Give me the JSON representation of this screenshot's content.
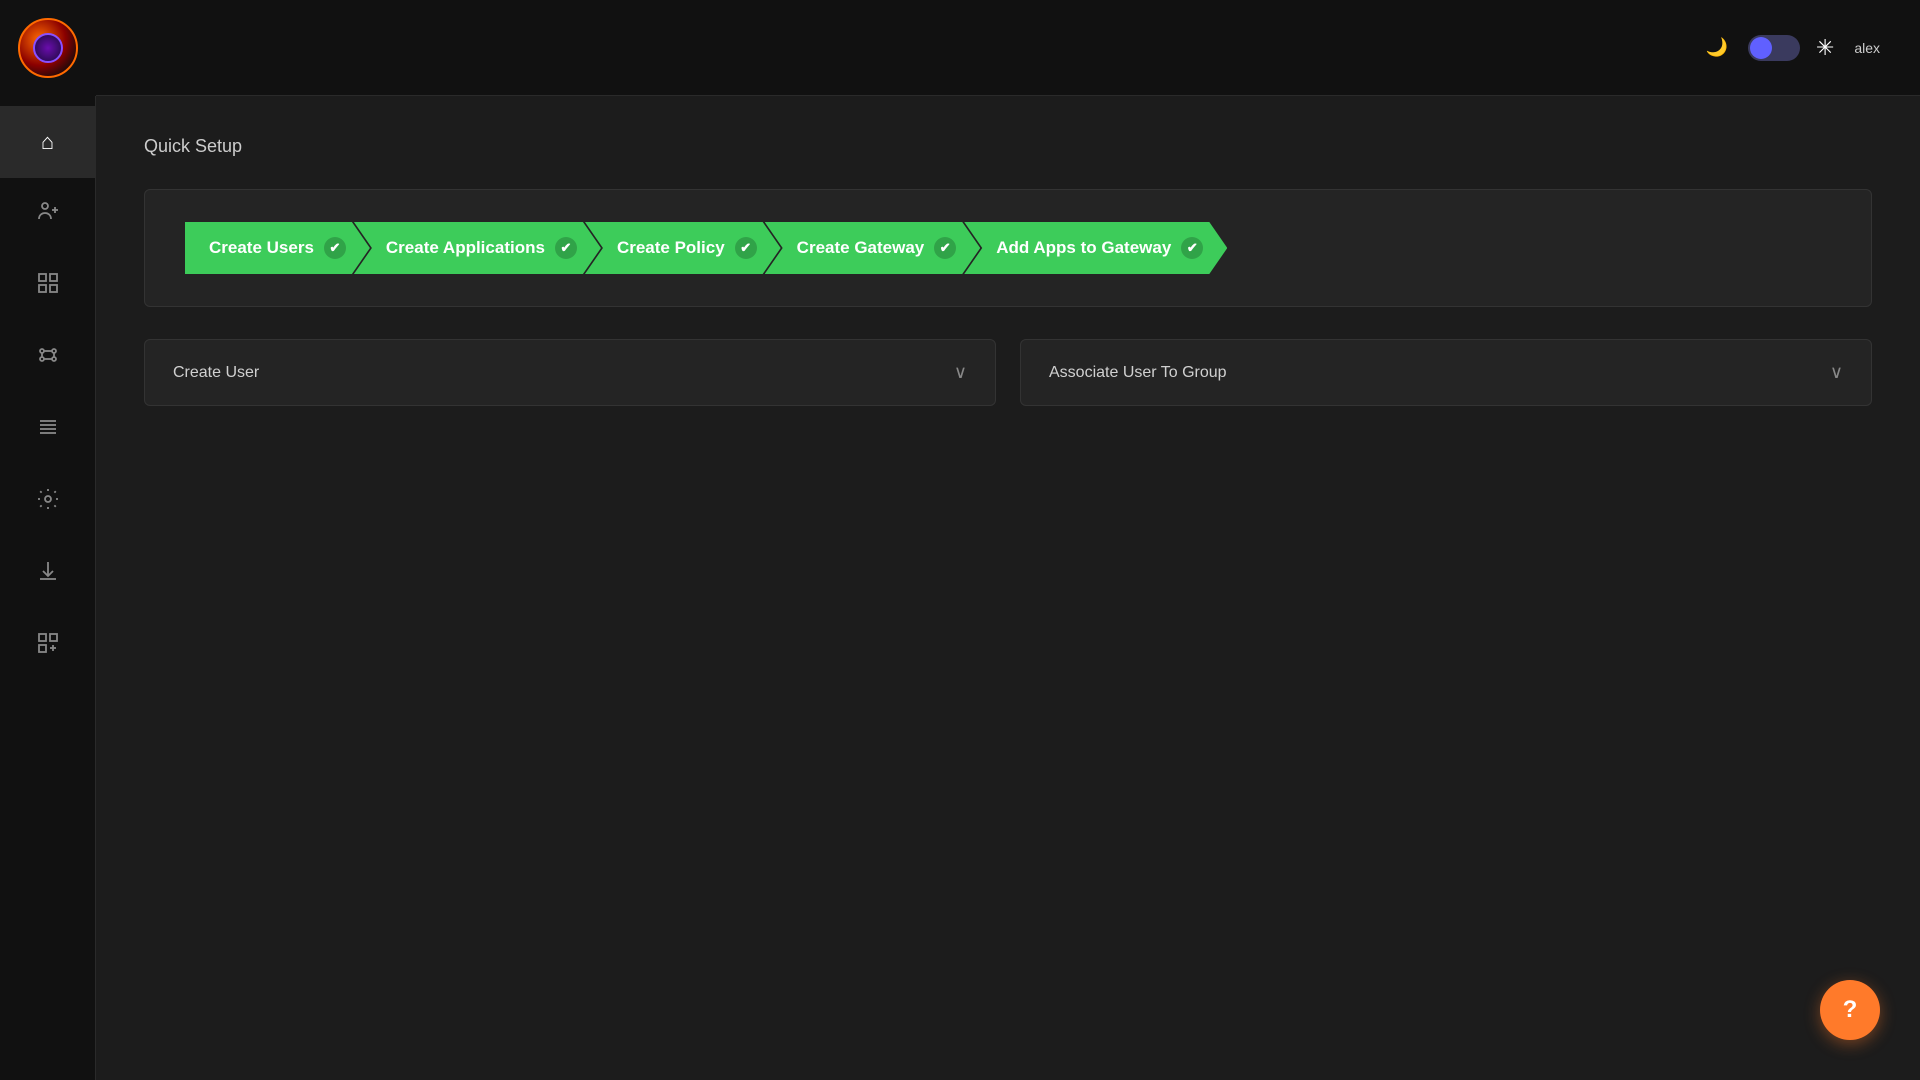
{
  "app": {
    "title": "Quick Setup",
    "logo_alt": "App Logo"
  },
  "topbar": {
    "user_label": "alex",
    "theme_toggle_label": "dark mode toggle",
    "snowflake_label": "settings icon"
  },
  "sidebar": {
    "nav_items": [
      {
        "id": "home",
        "icon": "⌂",
        "label": "Home",
        "active": true
      },
      {
        "id": "users",
        "icon": "👤",
        "label": "Users"
      },
      {
        "id": "grid",
        "icon": "⊞",
        "label": "Grid"
      },
      {
        "id": "connections",
        "icon": "⚡",
        "label": "Connections"
      },
      {
        "id": "list",
        "icon": "☰",
        "label": "List"
      },
      {
        "id": "settings",
        "icon": "⚙",
        "label": "Settings"
      },
      {
        "id": "download",
        "icon": "↓",
        "label": "Download"
      },
      {
        "id": "add-grid",
        "icon": "⊞",
        "label": "Add Grid"
      }
    ]
  },
  "steps": [
    {
      "id": "create-users",
      "label": "Create Users",
      "completed": true
    },
    {
      "id": "create-applications",
      "label": "Create Applications",
      "completed": true
    },
    {
      "id": "create-policy",
      "label": "Create Policy",
      "completed": true
    },
    {
      "id": "create-gateway",
      "label": "Create Gateway",
      "completed": true
    },
    {
      "id": "add-apps-to-gateway",
      "label": "Add Apps to Gateway",
      "completed": true
    }
  ],
  "check_symbol": "✔",
  "accordion_panels": [
    {
      "id": "create-user",
      "title": "Create User",
      "expanded": false,
      "chevron": "∨"
    },
    {
      "id": "associate-user-to-group",
      "title": "Associate User To Group",
      "expanded": false,
      "chevron": "∨"
    }
  ],
  "help_button": {
    "label": "?",
    "aria": "Help"
  }
}
